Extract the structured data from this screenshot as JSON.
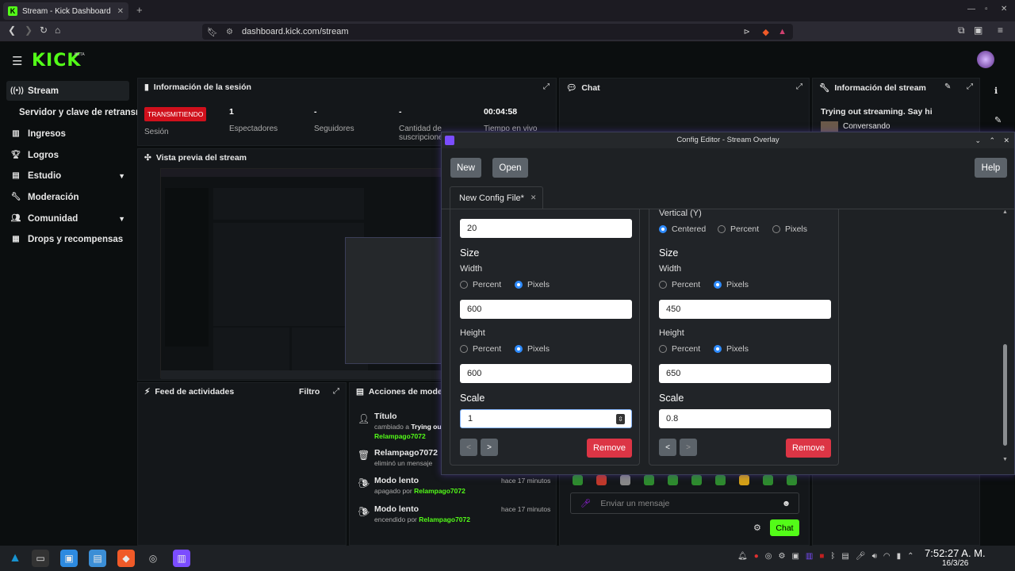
{
  "browser": {
    "tab_title": "Stream - Kick Dashboard",
    "url": "dashboard.kick.com/stream"
  },
  "kick": {
    "logo": "KICK",
    "beta": "BETA"
  },
  "sidebar": {
    "items": [
      {
        "label": "Stream",
        "icon": "broadcast-icon"
      },
      {
        "label": "Servidor y clave de retransm"
      },
      {
        "label": "Ingresos",
        "icon": "chart-icon"
      },
      {
        "label": "Logros",
        "icon": "trophy-icon"
      },
      {
        "label": "Estudio",
        "icon": "studio-icon"
      },
      {
        "label": "Moderación",
        "icon": "wrench-icon"
      },
      {
        "label": "Comunidad",
        "icon": "users-icon"
      },
      {
        "label": "Drops y recompensas",
        "icon": "gift-icon"
      }
    ]
  },
  "session": {
    "title": "Información de la sesión",
    "status": "TRANSMITIENDO",
    "status_label": "Sesión",
    "viewers_value": "1",
    "viewers_label": "Espectadores",
    "followers_value": "-",
    "followers_label": "Seguidores",
    "subs_value": "-",
    "subs_label": "Cantidad de suscripciones",
    "time_value": "00:04:58",
    "time_label": "Tiempo en vivo"
  },
  "chat": {
    "title": "Chat",
    "placeholder": "Enviar un mensaje",
    "send": "Chat"
  },
  "stream_info": {
    "title": "Información del stream",
    "stream_title": "Trying out streaming. Say hi",
    "category": "Conversando"
  },
  "preview": {
    "title": "Vista previa del stream"
  },
  "activity": {
    "title": "Feed de actividades",
    "filter": "Filtro"
  },
  "modactions": {
    "title": "Acciones de moderación",
    "items": [
      {
        "title": "Título",
        "line": "cambiado a ",
        "bold": "Trying out",
        "user": "Relampago7072",
        "time": ""
      },
      {
        "title": "Relampago7072",
        "line": "eliminó un mensaje",
        "bold": "",
        "user": "",
        "time": ""
      },
      {
        "title": "Modo lento",
        "line": "apagado por ",
        "bold": "",
        "user": "Relampago7072",
        "time": "hace 17 minutos"
      },
      {
        "title": "Modo lento",
        "line": "encendido por ",
        "bold": "",
        "user": "Relampago7072",
        "time": "hace 17 minutos"
      }
    ]
  },
  "dialog": {
    "title": "Config Editor - Stream Overlay",
    "new": "New",
    "open": "Open",
    "help": "Help",
    "file_tab": "New Config File*",
    "left": {
      "top_value": "20",
      "size": "Size",
      "width": "Width",
      "height": "Height",
      "scale": "Scale",
      "percent": "Percent",
      "pixels": "Pixels",
      "width_value": "600",
      "height_value": "600",
      "scale_value": "1",
      "remove": "Remove"
    },
    "right": {
      "vertical": "Vertical (Y)",
      "centered": "Centered",
      "percent": "Percent",
      "pixels": "Pixels",
      "size": "Size",
      "width": "Width",
      "height": "Height",
      "scale": "Scale",
      "width_value": "450",
      "height_value": "650",
      "scale_value": "0.8",
      "remove": "Remove"
    }
  },
  "taskbar": {
    "time": "7:52:27 A. M.",
    "date": "16/3/26"
  }
}
